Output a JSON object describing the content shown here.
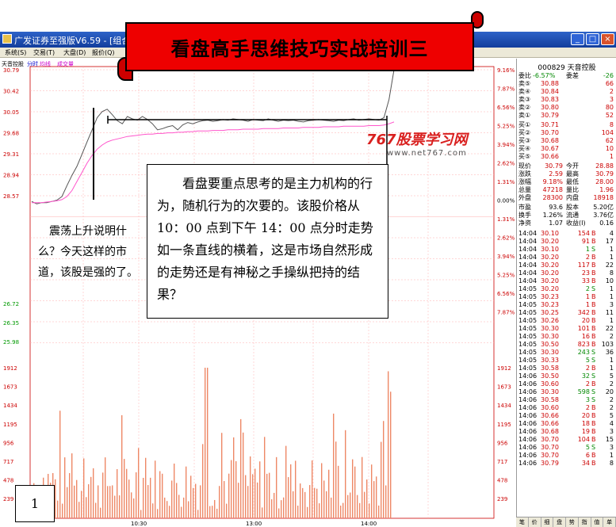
{
  "window": {
    "title": "广发证券至强版V6.59 - [组合图-天音控股]",
    "buttons": [
      "_",
      "□",
      "×"
    ]
  },
  "menu": [
    "系统(S)",
    "交易(T)",
    "大盘(D)",
    "报价(Q)"
  ],
  "banner": {
    "title": "看盘高手思维技巧实战培训三"
  },
  "chart": {
    "header_stock": "天音控股",
    "header_tabs": [
      "分时",
      "均线",
      "成交量"
    ],
    "price_axis": [
      "30.79",
      "30.42",
      "30.05",
      "29.68",
      "29.31",
      "28.94",
      "28.57"
    ],
    "pct_axis_top": [
      "9.16%",
      "7.87%",
      "6.56%",
      "5.25%",
      "3.94%",
      "2.62%",
      "1.31%",
      "0.00%",
      "1.31%",
      "2.62%",
      "3.94%",
      "5.25%",
      "6.56%",
      "7.87%"
    ],
    "lower_left_axis": [
      "26.72",
      "26.35",
      "25.98"
    ],
    "volume_axis": [
      "1912",
      "1673",
      "1434",
      "1195",
      "956",
      "717",
      "478",
      "239"
    ],
    "time_labels": [
      "10:30",
      "13:00",
      "14:00"
    ],
    "colors": {
      "price_line": "#555555",
      "avg_line": "#ff55cc",
      "volume_bar": "#ee8866",
      "grid": "#ffb0b0",
      "axis_text_red": "#cc0000"
    },
    "price_series": [
      28.62,
      28.58,
      28.6,
      28.6,
      28.62,
      28.64,
      28.7,
      28.88,
      29.05,
      29.2,
      29.4,
      29.6,
      29.8,
      30.0,
      30.1,
      30.14,
      30.05,
      29.95,
      29.9,
      30.02,
      29.98,
      29.96,
      30.02,
      29.97,
      29.9,
      29.8,
      29.82,
      29.85,
      29.87,
      29.8,
      29.88,
      29.92,
      29.9,
      29.93,
      29.95,
      29.96,
      29.94,
      29.95,
      29.97,
      29.96,
      29.98,
      29.97,
      29.96,
      29.94,
      29.97,
      29.96,
      29.95,
      29.98,
      29.96,
      29.94,
      29.96,
      29.95,
      29.96,
      29.94,
      29.93,
      29.95,
      29.96,
      29.97,
      29.96,
      29.95,
      29.94,
      29.96,
      29.95,
      29.97,
      29.98,
      29.96,
      29.97,
      29.98,
      29.97,
      29.96,
      30.0,
      30.3,
      30.79
    ],
    "avg_series": [
      28.6,
      28.6,
      28.6,
      28.61,
      28.62,
      28.63,
      28.65,
      28.7,
      28.8,
      28.95,
      29.1,
      29.25,
      29.38,
      29.48,
      29.55,
      29.6,
      29.63,
      29.65,
      29.67,
      29.69,
      29.7,
      29.71,
      29.72,
      29.73,
      29.73,
      29.74,
      29.74,
      29.75,
      29.75,
      29.76,
      29.76,
      29.77,
      29.77,
      29.78,
      29.78,
      29.78,
      29.79,
      29.79,
      29.79,
      29.8,
      29.8,
      29.8,
      29.81,
      29.81,
      29.81,
      29.81,
      29.82,
      29.82,
      29.82,
      29.82,
      29.83,
      29.83,
      29.83,
      29.83,
      29.84,
      29.84,
      29.84,
      29.84,
      29.85,
      29.85,
      29.85,
      29.85,
      29.86,
      29.86,
      29.86,
      29.86,
      29.86,
      29.87,
      29.87,
      29.87,
      29.88,
      29.9,
      29.93
    ]
  },
  "watermark": {
    "brand": "767股票学习网",
    "url": "www.net767.com"
  },
  "callout_main": "看盘要重点思考的是主力机构的行为，随机行为的次要的。该股价格从10：00 点到下午 14：00 点分时走势如一条直线的横着，这是市场自然形成的走势还是有神秘之手操纵把持的结果？",
  "callout_left": "震荡上升说明什么？今天这样的市道，该股是强的了。",
  "page_number": "1",
  "panel": {
    "stock_header": "000829 天音控股",
    "ratio_row": {
      "l1": "委比",
      "v1": "-6.57%",
      "l2": "委差",
      "v2": "-26"
    },
    "sells": [
      {
        "label": "卖⑤",
        "price": "30.88",
        "vol": "66"
      },
      {
        "label": "卖④",
        "price": "30.84",
        "vol": "2"
      },
      {
        "label": "卖③",
        "price": "30.83",
        "vol": "3"
      },
      {
        "label": "卖②",
        "price": "30.80",
        "vol": "80"
      },
      {
        "label": "卖①",
        "price": "30.79",
        "vol": "52"
      }
    ],
    "buys": [
      {
        "label": "买①",
        "price": "30.71",
        "vol": "8"
      },
      {
        "label": "买②",
        "price": "30.70",
        "vol": "104"
      },
      {
        "label": "买③",
        "price": "30.68",
        "vol": "62"
      },
      {
        "label": "买④",
        "price": "30.67",
        "vol": "10"
      },
      {
        "label": "买⑤",
        "price": "30.66",
        "vol": "1"
      }
    ],
    "stats": [
      {
        "l1": "现价",
        "v1": "30.79",
        "l2": "今开",
        "v2": "28.88"
      },
      {
        "l1": "涨跌",
        "v1": "2.59",
        "l2": "最高",
        "v2": "30.79"
      },
      {
        "l1": "涨幅",
        "v1": "9.18%",
        "l2": "最低",
        "v2": "28.00"
      },
      {
        "l1": "总量",
        "v1": "47218",
        "l2": "量比",
        "v2": "1.96"
      },
      {
        "l1": "外盘",
        "v1": "28300",
        "l2": "内盘",
        "v2": "18918"
      }
    ],
    "stats2": [
      {
        "l1": "市盈",
        "v1": "93.6",
        "l2": "股本",
        "v2": "5.20亿"
      },
      {
        "l1": "换手",
        "v1": "1.26%",
        "l2": "流通",
        "v2": "3.76亿"
      },
      {
        "l1": "净资",
        "v1": "1.07",
        "l2": "收益(I)",
        "v2": "0.16"
      }
    ],
    "ticks": [
      [
        "14:04",
        "30.10",
        "154",
        "B",
        "4"
      ],
      [
        "14:04",
        "30.20",
        "91",
        "B",
        "17"
      ],
      [
        "14:04",
        "30.10",
        "1",
        "S",
        "1"
      ],
      [
        "14:04",
        "30.20",
        "2",
        "B",
        "1"
      ],
      [
        "14:04",
        "30.20",
        "117",
        "B",
        "22"
      ],
      [
        "14:04",
        "30.20",
        "23",
        "B",
        "8"
      ],
      [
        "14:04",
        "30.20",
        "33",
        "B",
        "10"
      ],
      [
        "14:05",
        "30.20",
        "2",
        "S",
        "1"
      ],
      [
        "14:05",
        "30.23",
        "1",
        "B",
        "1"
      ],
      [
        "14:05",
        "30.23",
        "1",
        "B",
        "3"
      ],
      [
        "14:05",
        "30.25",
        "342",
        "B",
        "11"
      ],
      [
        "14:05",
        "30.26",
        "20",
        "B",
        "1"
      ],
      [
        "14:05",
        "30.30",
        "101",
        "B",
        "22"
      ],
      [
        "14:05",
        "30.30",
        "16",
        "B",
        "2"
      ],
      [
        "14:05",
        "30.50",
        "823",
        "B",
        "103"
      ],
      [
        "14:05",
        "30.30",
        "243",
        "S",
        "36"
      ],
      [
        "14:05",
        "30.33",
        "5",
        "S",
        "1"
      ],
      [
        "14:05",
        "30.58",
        "2",
        "B",
        "1"
      ],
      [
        "14:06",
        "30.50",
        "32",
        "S",
        "5"
      ],
      [
        "14:06",
        "30.60",
        "2",
        "B",
        "2"
      ],
      [
        "14:06",
        "30.30",
        "598",
        "S",
        "20"
      ],
      [
        "14:06",
        "30.58",
        "3",
        "S",
        "2"
      ],
      [
        "14:06",
        "30.60",
        "2",
        "B",
        "2"
      ],
      [
        "14:06",
        "30.66",
        "20",
        "B",
        "5"
      ],
      [
        "14:06",
        "30.66",
        "18",
        "B",
        "4"
      ],
      [
        "14:06",
        "30.68",
        "19",
        "B",
        "3"
      ],
      [
        "14:06",
        "30.70",
        "104",
        "B",
        "15"
      ],
      [
        "14:06",
        "30.70",
        "5",
        "S",
        "3"
      ],
      [
        "14:06",
        "30.70",
        "6",
        "B",
        "1"
      ],
      [
        "14:06",
        "30.79",
        "34",
        "B",
        "8"
      ]
    ],
    "tabs": [
      "笔",
      "价",
      "细",
      "盘",
      "势",
      "指",
      "值",
      "单"
    ]
  }
}
